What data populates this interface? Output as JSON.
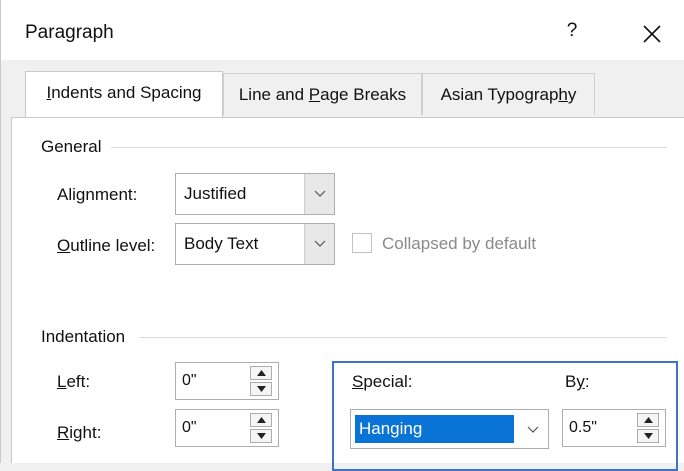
{
  "dialog": {
    "title": "Paragraph",
    "help_glyph": "?"
  },
  "tabs": [
    {
      "pre": "",
      "key": "I",
      "post": "ndents and Spacing",
      "active": true
    },
    {
      "pre": "Line and ",
      "key": "P",
      "post": "age Breaks",
      "active": false
    },
    {
      "pre": "Asian Typograp",
      "key": "h",
      "post": "y",
      "active": false
    }
  ],
  "general": {
    "section_label": "General",
    "alignment": {
      "pre": "Ali",
      "key": "g",
      "post": "nment:",
      "value": "Justified"
    },
    "outline_level": {
      "pre": "",
      "key": "O",
      "post": "utline level:",
      "value": "Body Text"
    },
    "collapsed": {
      "label": "Collapsed by default",
      "checked": false,
      "enabled": false
    }
  },
  "indentation": {
    "section_label": "Indentation",
    "left": {
      "pre": "",
      "key": "L",
      "post": "eft:",
      "value": "0\""
    },
    "right": {
      "pre": "",
      "key": "R",
      "post": "ight:",
      "value": "0\""
    },
    "special": {
      "pre": "",
      "key": "S",
      "post": "pecial:",
      "value": "Hanging"
    },
    "by": {
      "pre": "B",
      "key": "y",
      "post": ":",
      "value": "0.5\""
    }
  },
  "icons": {
    "close": "close-icon",
    "chevron": "chevron-down-icon",
    "spin_up": "spin-up-arrow-icon",
    "spin_down": "spin-down-arrow-icon"
  },
  "colors": {
    "focus_border": "#3f73c8",
    "selection": "#0a74d6"
  }
}
